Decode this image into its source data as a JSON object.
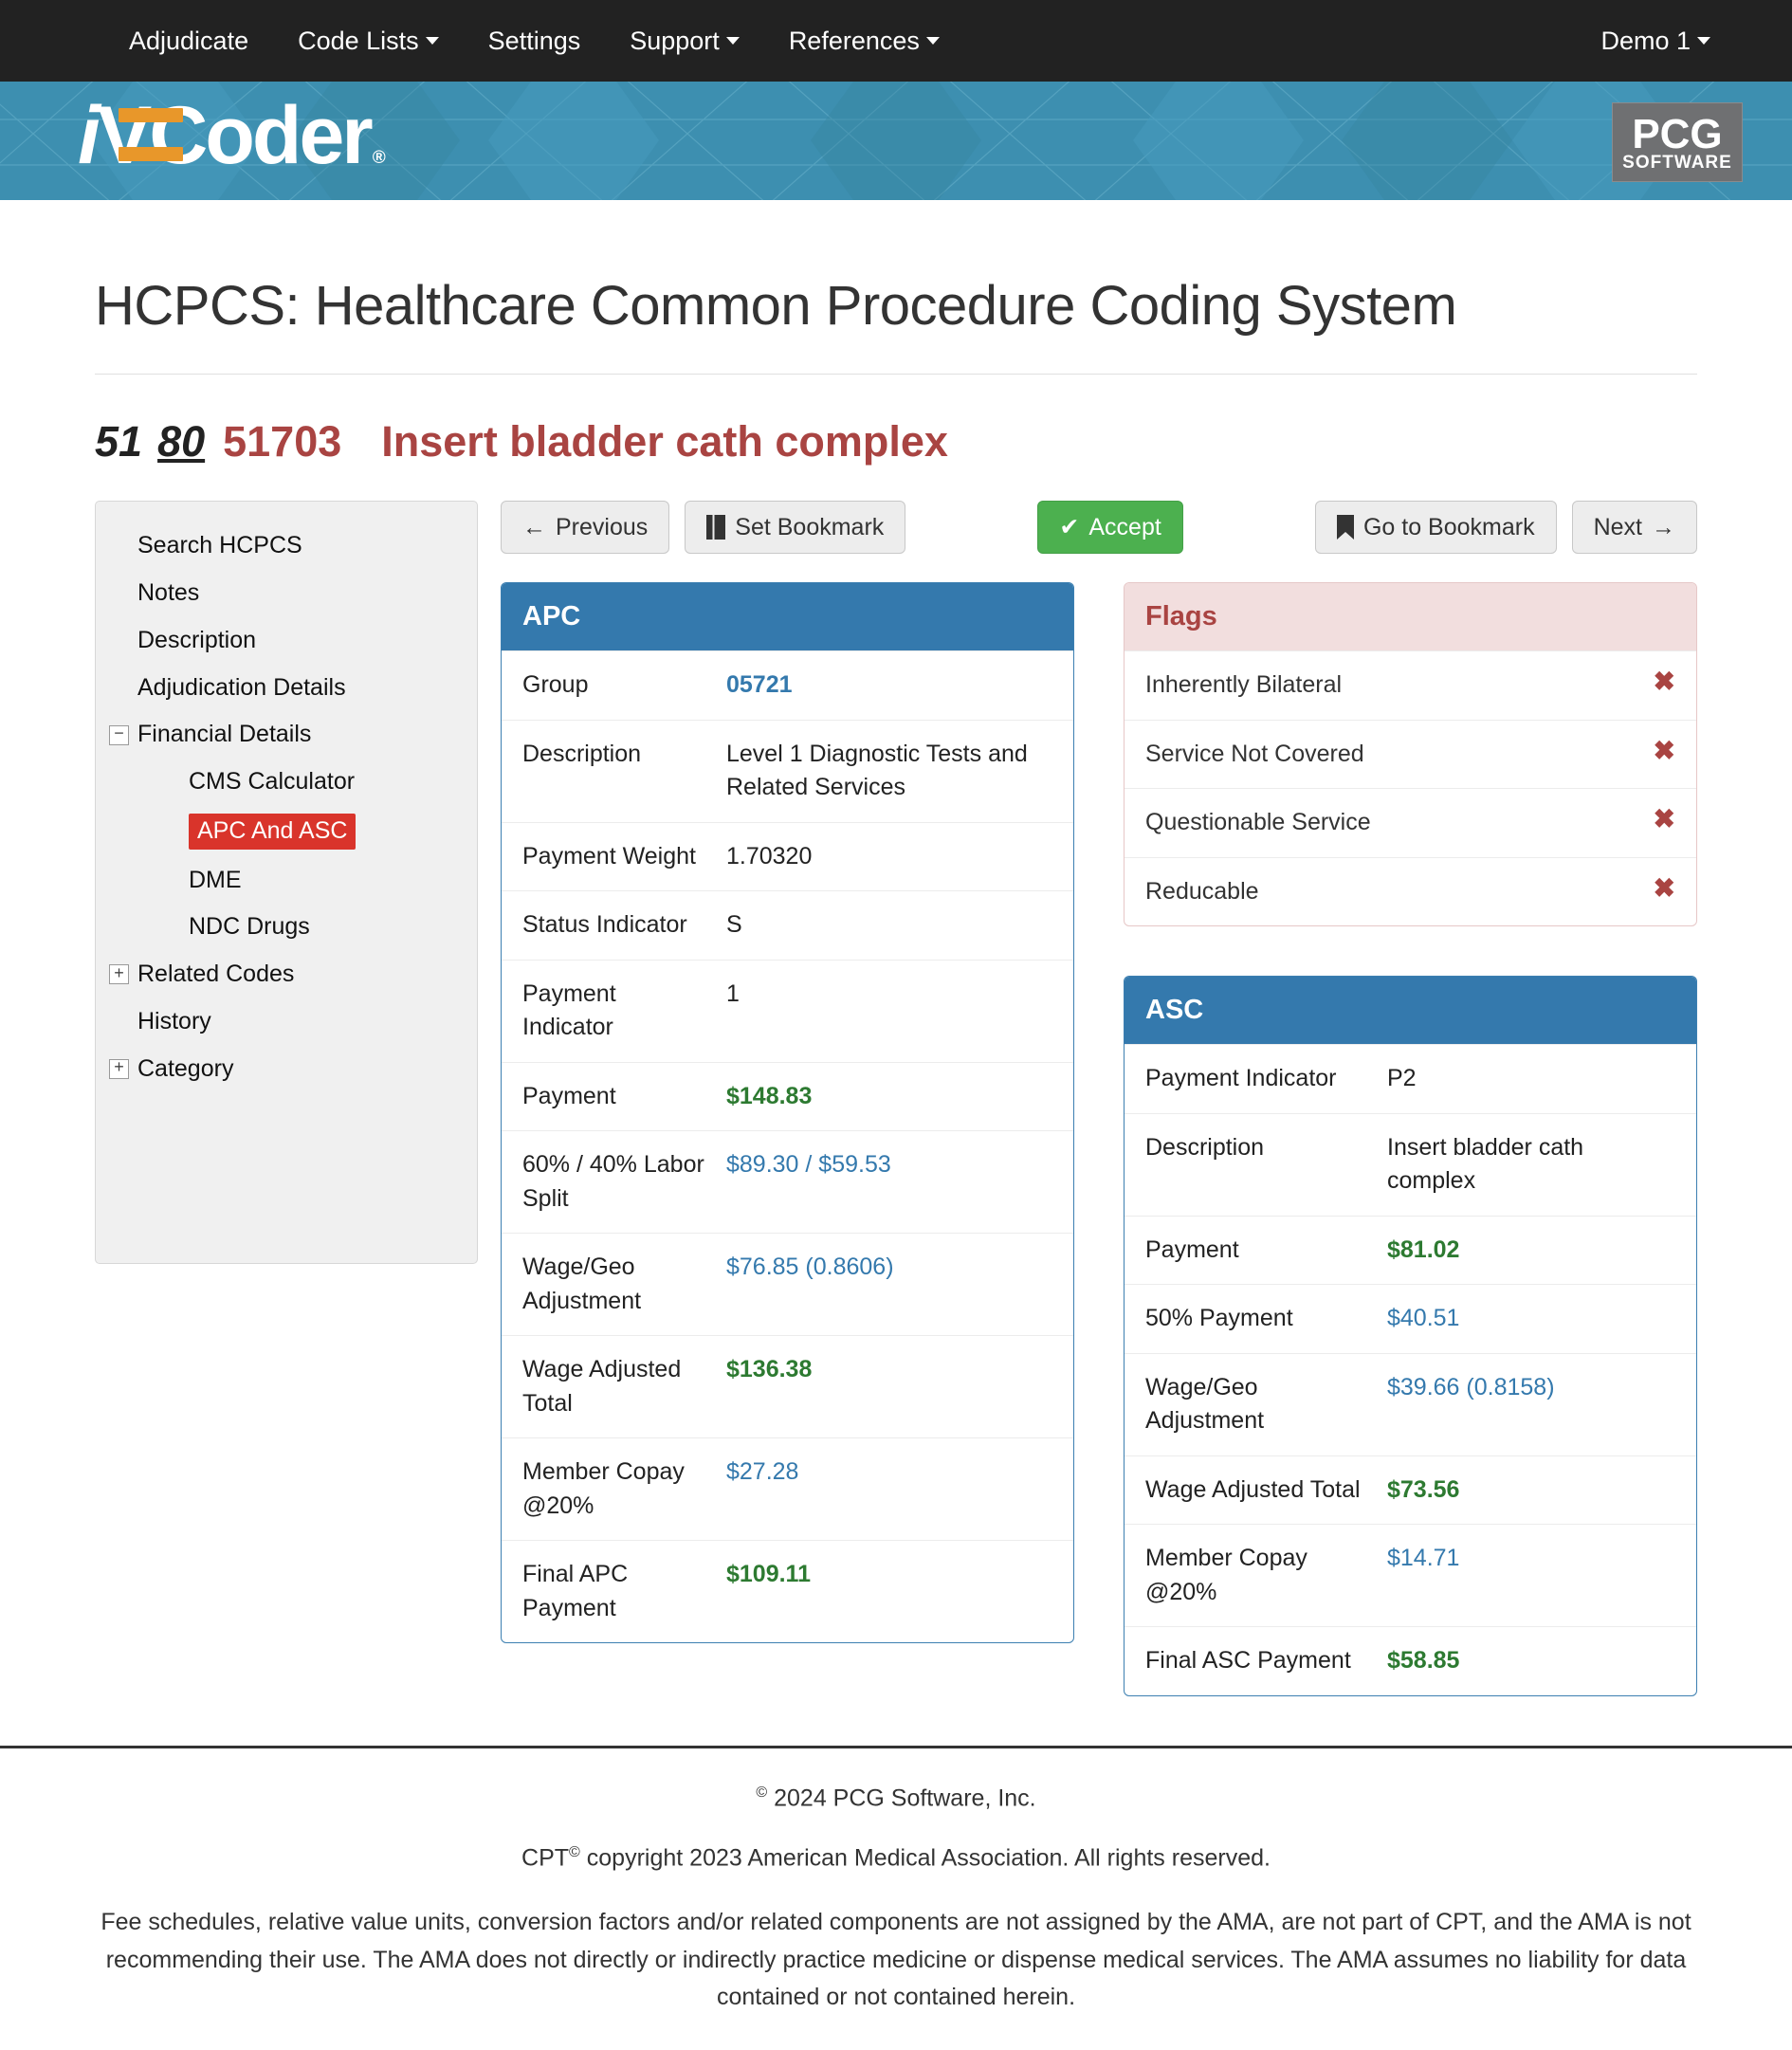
{
  "nav": {
    "items": [
      {
        "label": "Adjudicate",
        "caret": false
      },
      {
        "label": "Code Lists",
        "caret": true
      },
      {
        "label": "Settings",
        "caret": false
      },
      {
        "label": "Support",
        "caret": true
      },
      {
        "label": "References",
        "caret": true
      }
    ],
    "user": "Demo 1"
  },
  "brand": {
    "logo_i": "i",
    "logo_v": "V",
    "logo_rest": "Coder",
    "registered": "®",
    "pcg_top": "PCG",
    "pcg_bottom": "SOFTWARE"
  },
  "page": {
    "title": "HCPCS: Healthcare Common Procedure Coding System",
    "modifier_1": "51",
    "modifier_2": "80",
    "code": "51703",
    "code_description": "Insert bladder cath complex"
  },
  "sidebar": {
    "items": [
      {
        "label": "Search HCPCS",
        "level": 1,
        "toggle": null,
        "active": false
      },
      {
        "label": "Notes",
        "level": 1,
        "toggle": null,
        "active": false
      },
      {
        "label": "Description",
        "level": 1,
        "toggle": null,
        "active": false
      },
      {
        "label": "Adjudication Details",
        "level": 1,
        "toggle": null,
        "active": false
      },
      {
        "label": "Financial Details",
        "level": 1,
        "toggle": "−",
        "active": false
      },
      {
        "label": "CMS Calculator",
        "level": 2,
        "toggle": null,
        "active": false
      },
      {
        "label": "APC And ASC",
        "level": 2,
        "toggle": null,
        "active": true
      },
      {
        "label": "DME",
        "level": 2,
        "toggle": null,
        "active": false
      },
      {
        "label": "NDC Drugs",
        "level": 2,
        "toggle": null,
        "active": false
      },
      {
        "label": "Related Codes",
        "level": 1,
        "toggle": "+",
        "active": false
      },
      {
        "label": "History",
        "level": 1,
        "toggle": null,
        "active": false
      },
      {
        "label": "Category",
        "level": 1,
        "toggle": "+",
        "active": false
      }
    ]
  },
  "toolbar": {
    "previous": "Previous",
    "previous_icon": "←",
    "set_bookmark": "Set Bookmark",
    "set_bookmark_icon": "▌▐",
    "accept": "Accept",
    "accept_icon": "✔",
    "go_to_bookmark": "Go to Bookmark",
    "go_to_bookmark_icon": "⚑",
    "next": "Next",
    "next_icon": "→"
  },
  "apc": {
    "title": "APC",
    "rows": [
      {
        "key": "Group",
        "value": "05721",
        "style": "blue-bold"
      },
      {
        "key": "Description",
        "value": "Level 1 Diagnostic Tests and Related Services",
        "style": "plain"
      },
      {
        "key": "Payment Weight",
        "value": "1.70320",
        "style": "plain"
      },
      {
        "key": "Status Indicator",
        "value": "S",
        "style": "plain"
      },
      {
        "key": "Payment Indicator",
        "value": "1",
        "style": "plain"
      },
      {
        "key": "Payment",
        "value": "$148.83",
        "style": "green"
      },
      {
        "key": "60% / 40% Labor Split",
        "value": "$89.30 / $59.53",
        "style": "blue"
      },
      {
        "key": "Wage/Geo Adjustment",
        "value": "$76.85 (0.8606)",
        "style": "blue"
      },
      {
        "key": "Wage Adjusted Total",
        "value": "$136.38",
        "style": "green"
      },
      {
        "key": "Member Copay @20%",
        "value": "$27.28",
        "style": "blue"
      },
      {
        "key": "Final APC Payment",
        "value": "$109.11",
        "style": "green"
      }
    ]
  },
  "flags": {
    "title": "Flags",
    "mark": "✖",
    "rows": [
      {
        "key": "Inherently Bilateral"
      },
      {
        "key": "Service Not Covered"
      },
      {
        "key": "Questionable Service"
      },
      {
        "key": "Reducable"
      }
    ]
  },
  "asc": {
    "title": "ASC",
    "rows": [
      {
        "key": "Payment Indicator",
        "value": "P2",
        "style": "plain"
      },
      {
        "key": "Description",
        "value": "Insert bladder cath complex",
        "style": "plain"
      },
      {
        "key": "Payment",
        "value": "$81.02",
        "style": "green"
      },
      {
        "key": "50% Payment",
        "value": "$40.51",
        "style": "blue"
      },
      {
        "key": "Wage/Geo Adjustment",
        "value": "$39.66 (0.8158)",
        "style": "blue"
      },
      {
        "key": "Wage Adjusted Total",
        "value": "$73.56",
        "style": "green"
      },
      {
        "key": "Member Copay @20%",
        "value": "$14.71",
        "style": "blue"
      },
      {
        "key": "Final ASC Payment",
        "value": "$58.85",
        "style": "green"
      }
    ]
  },
  "footer": {
    "copyright_sup": "©",
    "copyright": " 2024 PCG Software, Inc.",
    "cpt_prefix": "CPT",
    "cpt_sup": "©",
    "cpt_rest": " copyright 2023 American Medical Association. All rights reserved.",
    "disclaimer": "Fee schedules, relative value units, conversion factors and/or related components are not assigned by the AMA, are not part of CPT, and the AMA is not recommending their use. The AMA does not directly or indirectly practice medicine or dispense medical services. The AMA assumes no liability for data contained or not contained herein."
  },
  "colors": {
    "nav_bg": "#222222",
    "banner": "#3d8fb0",
    "accent_blue": "#3479ad",
    "accent_orange": "#e8972a",
    "danger_red": "#a94442",
    "active_red": "#d9342b",
    "money_green": "#2d7a31",
    "accept_green": "#4cb04f"
  }
}
